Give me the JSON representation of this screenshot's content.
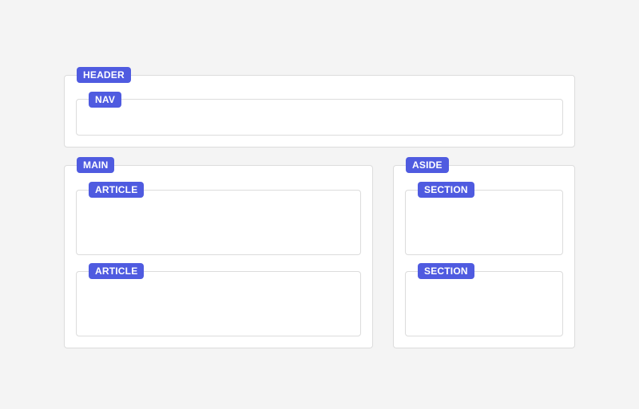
{
  "colors": {
    "background": "#f4f4f4",
    "box_fill": "#ffffff",
    "box_border": "#dcdcdc",
    "tag_fill": "#4f5be0",
    "tag_text": "#ffffff"
  },
  "header": {
    "label": "HEADER",
    "nav": {
      "label": "NAV"
    }
  },
  "main": {
    "label": "MAIN",
    "articles": [
      {
        "label": "ARTICLE"
      },
      {
        "label": "ARTICLE"
      }
    ]
  },
  "aside": {
    "label": "ASIDE",
    "sections": [
      {
        "label": "SECTION"
      },
      {
        "label": "SECTION"
      }
    ]
  }
}
